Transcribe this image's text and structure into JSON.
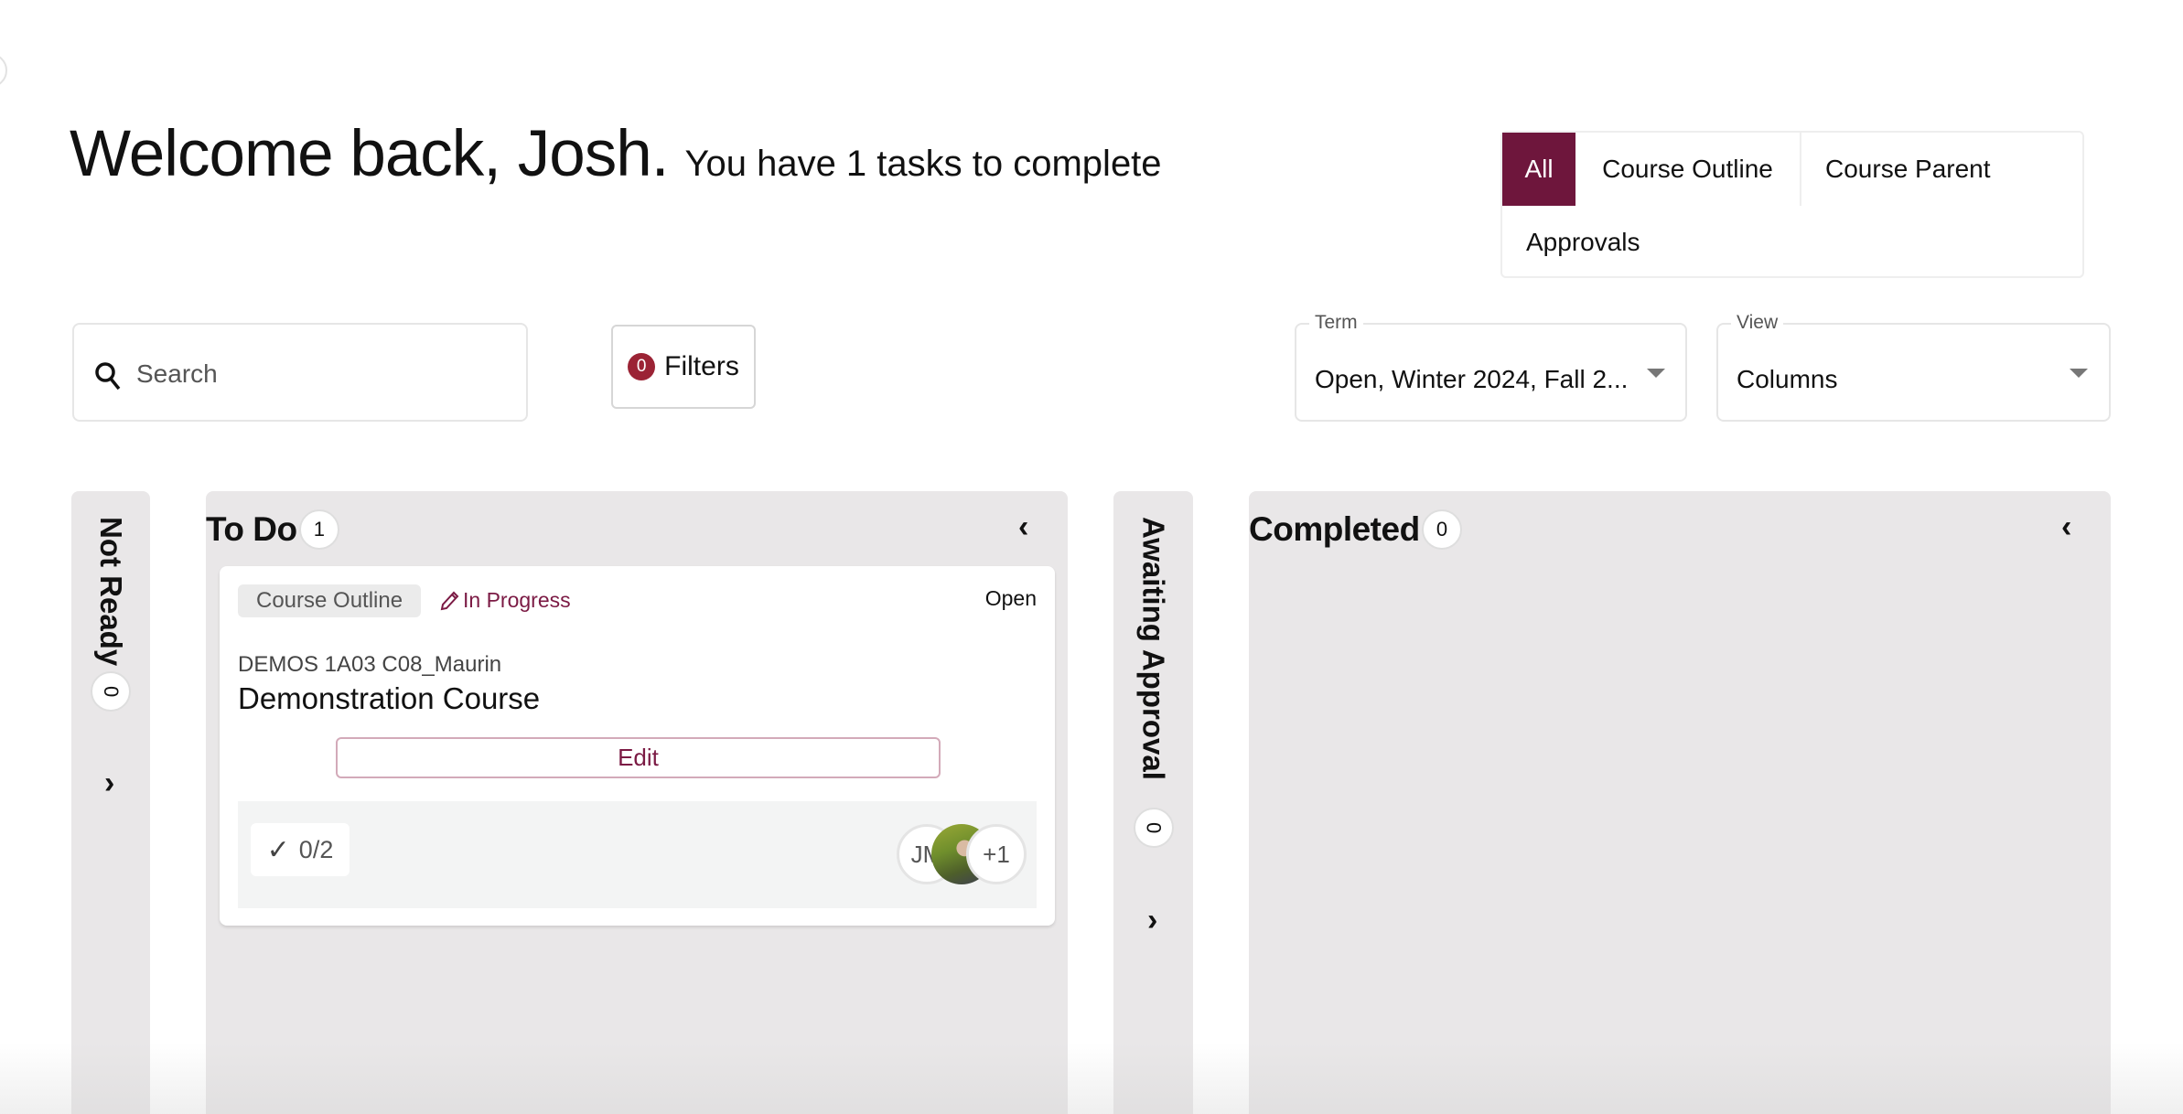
{
  "header": {
    "greeting": "Welcome back, Josh.",
    "task_summary": "You have 1 tasks to complete"
  },
  "type_tabs": [
    {
      "label": "All",
      "active": true
    },
    {
      "label": "Course Outline",
      "active": false
    },
    {
      "label": "Course Parent",
      "active": false
    },
    {
      "label": "Approvals",
      "active": false
    }
  ],
  "search": {
    "placeholder": "Search",
    "value": ""
  },
  "filters": {
    "count": "0",
    "label": "Filters"
  },
  "term_select": {
    "label": "Term",
    "value": "Open, Winter 2024, Fall 2..."
  },
  "view_select": {
    "label": "View",
    "value": "Columns"
  },
  "colors": {
    "accent": "#6e163c",
    "filter_badge": "#9b2335",
    "column_bg": "#e9e7e8"
  },
  "columns": [
    {
      "title": "Not Ready",
      "count": "0",
      "collapsed": true,
      "toggle_icon": "chevron-right"
    },
    {
      "title": "To Do",
      "count": "1",
      "collapsed": false,
      "toggle_icon": "chevron-left",
      "cards": [
        {
          "type": "Course Outline",
          "status": "In Progress",
          "term": "Open",
          "course_code": "DEMOS 1A03 C08_Maurin",
          "course_name": "Demonstration Course",
          "action": "Edit",
          "checklist": "0/2",
          "assignees": [
            {
              "initials": "JM"
            },
            {
              "photo": true
            },
            {
              "overflow": "+1"
            }
          ]
        }
      ]
    },
    {
      "title": "Awaiting Approval",
      "count": "0",
      "collapsed": true,
      "toggle_icon": "chevron-right"
    },
    {
      "title": "Completed",
      "count": "0",
      "collapsed": false,
      "toggle_icon": "chevron-left",
      "cards": []
    }
  ]
}
